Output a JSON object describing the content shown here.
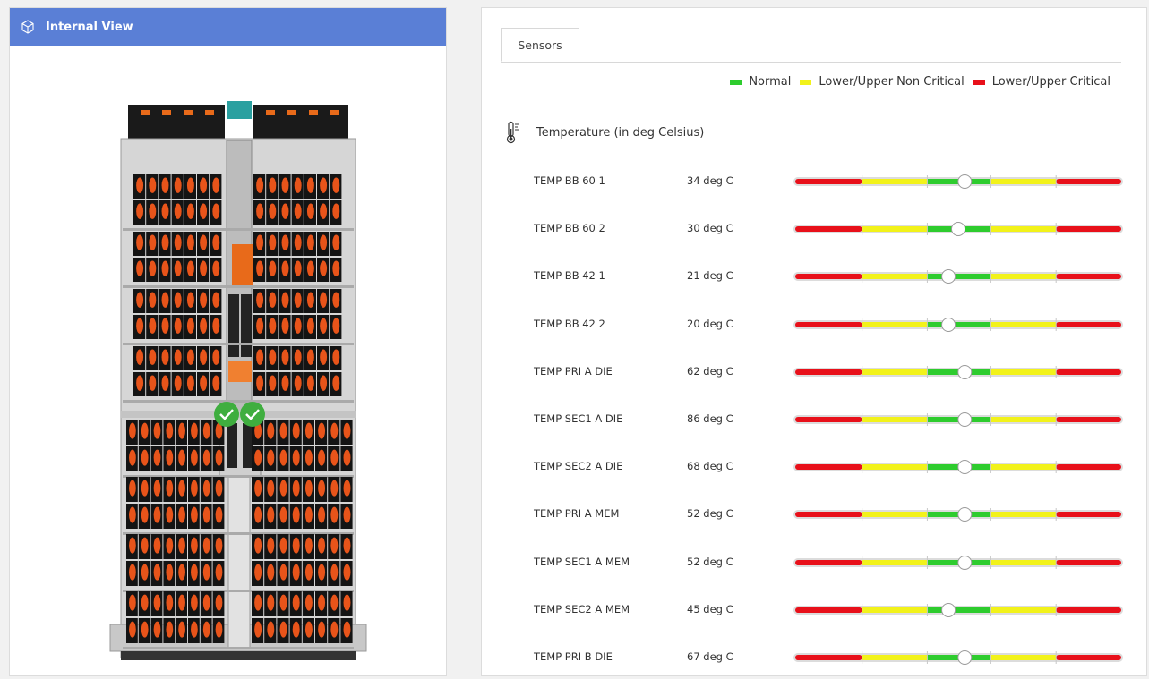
{
  "left_panel": {
    "title": "Internal View",
    "title_icon": "cube-icon",
    "status_icons": [
      "check-circle-icon",
      "check-circle-icon"
    ]
  },
  "right_panel": {
    "tabs": [
      {
        "label": "Sensors",
        "active": true
      }
    ],
    "legend": [
      {
        "label": "Normal",
        "color": "#2ecc2e"
      },
      {
        "label": "Lower/Upper Non Critical",
        "color": "#f2f21a"
      },
      {
        "label": "Lower/Upper Critical",
        "color": "#e8101a"
      }
    ],
    "section": {
      "title": "Temperature (in deg Celsius)",
      "icon": "thermometer-icon"
    },
    "sensors": [
      {
        "name": "TEMP BB 60 1",
        "value": "34 deg C",
        "level": 0.52
      },
      {
        "name": "TEMP BB 60 2",
        "value": "30 deg C",
        "level": 0.5
      },
      {
        "name": "TEMP BB 42 1",
        "value": "21 deg C",
        "level": 0.47
      },
      {
        "name": "TEMP BB 42 2",
        "value": "20 deg C",
        "level": 0.47
      },
      {
        "name": "TEMP PRI A DIE",
        "value": "62 deg C",
        "level": 0.52
      },
      {
        "name": "TEMP SEC1 A DIE",
        "value": "86 deg C",
        "level": 0.52
      },
      {
        "name": "TEMP SEC2 A DIE",
        "value": "68 deg C",
        "level": 0.52
      },
      {
        "name": "TEMP PRI A MEM",
        "value": "52 deg C",
        "level": 0.52
      },
      {
        "name": "TEMP SEC1 A MEM",
        "value": "52 deg C",
        "level": 0.52
      },
      {
        "name": "TEMP SEC2 A MEM",
        "value": "45 deg C",
        "level": 0.47
      },
      {
        "name": "TEMP PRI B DIE",
        "value": "67 deg C",
        "level": 0.52
      }
    ],
    "gauge_colors": {
      "critical": "#e8101a",
      "non_critical": "#f2f21a",
      "normal": "#2ecc2e"
    }
  }
}
